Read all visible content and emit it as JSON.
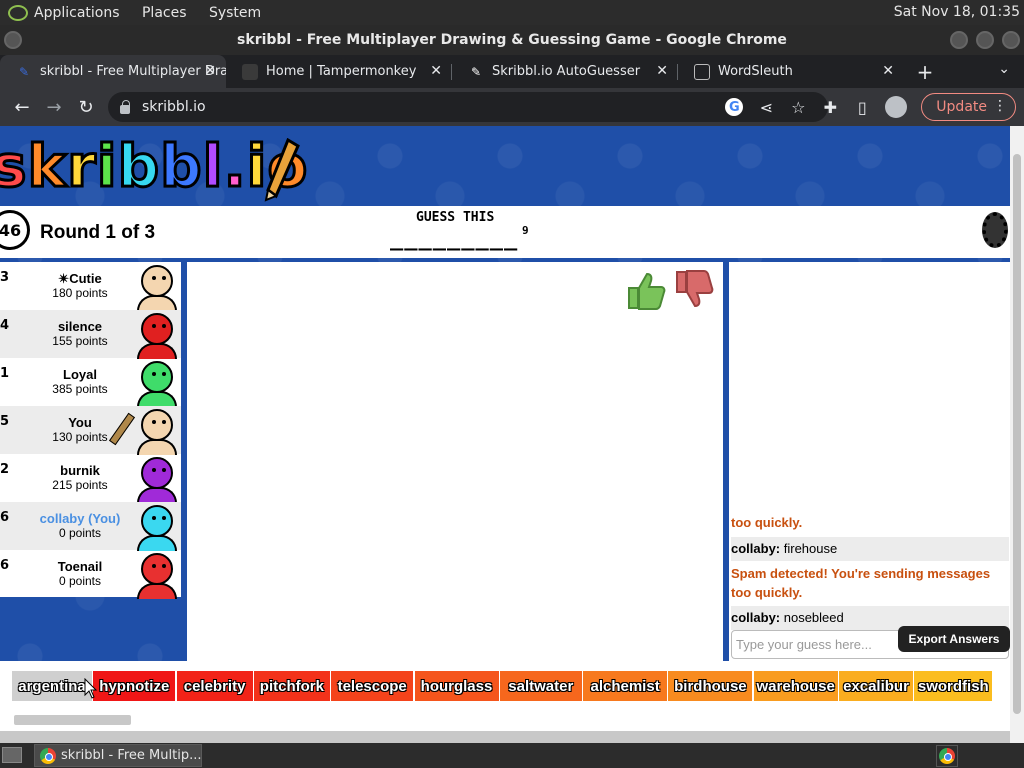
{
  "os": {
    "menu": [
      "Applications",
      "Places",
      "System"
    ],
    "clock": "Sat Nov 18, 01:35"
  },
  "window": {
    "title": "skribbl - Free Multiplayer Drawing & Guessing Game - Google Chrome"
  },
  "tabs": [
    {
      "label": "skribbl - Free Multiplayer Drawing",
      "icon": "skribbl-pencil-icon",
      "icon_color": "#3a6bdc",
      "active": true
    },
    {
      "label": "Home | Tampermonkey",
      "icon": "tampermonkey-icon",
      "icon_color": "#3a3a3a",
      "active": false
    },
    {
      "label": "Skribbl.io AutoGuesser",
      "icon": "autoguesser-icon",
      "icon_color": "#202124",
      "active": false
    },
    {
      "label": "WordSleuth",
      "icon": "github-icon",
      "icon_color": "#202124",
      "active": false
    }
  ],
  "toolbar": {
    "url": "skribbl.io",
    "update_label": "Update"
  },
  "game": {
    "logo_letters": [
      {
        "ch": "s",
        "color": "#ff4b4b"
      },
      {
        "ch": "k",
        "color": "#ff8a2a"
      },
      {
        "ch": "r",
        "color": "#ffd83a"
      },
      {
        "ch": "i",
        "color": "#5de34a"
      },
      {
        "ch": "b",
        "color": "#37d8f0"
      },
      {
        "ch": "b",
        "color": "#3c78ff"
      },
      {
        "ch": "l",
        "color": "#b14cff"
      },
      {
        "ch": ".",
        "color": "#ff5fcf"
      },
      {
        "ch": "i",
        "color": "#ffd83a"
      },
      {
        "ch": "o",
        "color": "#ff8a2a"
      }
    ],
    "timer": "46",
    "round": "Round 1 of 3",
    "guess_label": "GUESS THIS",
    "guess_word": "_________",
    "guess_length": "9"
  },
  "players": [
    {
      "rank": "3",
      "name": "✴Cutie",
      "points": "180 points",
      "avatar_color": "#f4d6b0",
      "me": false
    },
    {
      "rank": "4",
      "name": "silence",
      "points": "155 points",
      "avatar_color": "#e02020",
      "me": false
    },
    {
      "rank": "1",
      "name": "Loyal",
      "points": "385 points",
      "avatar_color": "#3fdc6a",
      "me": false
    },
    {
      "rank": "5",
      "name": "You",
      "points": "130 points",
      "avatar_color": "#f4d6b0",
      "me": false,
      "drawing": true
    },
    {
      "rank": "2",
      "name": "burnik",
      "points": "215 points",
      "avatar_color": "#a02ad8",
      "me": false
    },
    {
      "rank": "6",
      "name": "collaby (You)",
      "points": "0 points",
      "avatar_color": "#3ad8f0",
      "me": true
    },
    {
      "rank": "6",
      "name": "Toenail",
      "points": "0 points",
      "avatar_color": "#e83030",
      "me": false
    }
  ],
  "chat": {
    "messages": [
      {
        "type": "system",
        "text": "too quickly."
      },
      {
        "type": "user",
        "user": "collaby:",
        "text": " firehouse"
      },
      {
        "type": "system",
        "text": "Spam detected! You're sending messages too quickly."
      },
      {
        "type": "user",
        "user": "collaby:",
        "text": " nosebleed"
      }
    ],
    "input_placeholder": "Type your guess here...",
    "export_label": "Export Answers"
  },
  "words": [
    {
      "text": "argentina",
      "color": "#cfcfcf"
    },
    {
      "text": "hypnotize",
      "color": "#f01616"
    },
    {
      "text": "celebrity",
      "color": "#f22318"
    },
    {
      "text": "pitchfork",
      "color": "#f3321a"
    },
    {
      "text": "telescope",
      "color": "#f4431b"
    },
    {
      "text": "hourglass",
      "color": "#f5551c"
    },
    {
      "text": "saltwater",
      "color": "#f6671d"
    },
    {
      "text": "alchemist",
      "color": "#f7791e"
    },
    {
      "text": "birdhouse",
      "color": "#f88b1f"
    },
    {
      "text": "warehouse",
      "color": "#f99c1f"
    },
    {
      "text": "excalibur",
      "color": "#faad1f"
    },
    {
      "text": "swordfish",
      "color": "#fbbd1f"
    }
  ],
  "taskbar": {
    "item_label": "skribbl - Free Multip..."
  }
}
